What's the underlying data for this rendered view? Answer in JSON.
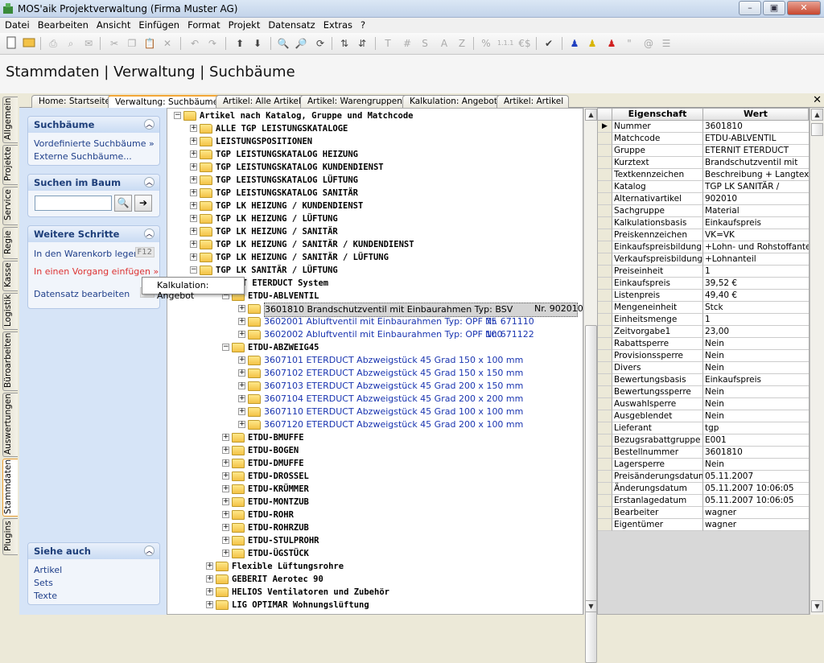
{
  "window": {
    "title": "MOS'aik Projektverwaltung (Firma Muster AG)",
    "min": "–",
    "max": "▣",
    "close": "✕"
  },
  "menu": [
    "Datei",
    "Bearbeiten",
    "Ansicht",
    "Einfügen",
    "Format",
    "Projekt",
    "Datensatz",
    "Extras",
    "?"
  ],
  "toolbar": {
    "t1": "T",
    "t2": "#",
    "t3": "S",
    "t4": "A",
    "t5": "Z",
    "t6": "%",
    "t7": "1.1.1",
    "t8": "€$",
    "t9": "\"",
    "t10": "@"
  },
  "page_title": "Stammdaten | Verwaltung | Suchbäume",
  "side_tabs": [
    "Allgemein",
    "Projekte",
    "Service",
    "Regie",
    "Kasse",
    "Logistik",
    "Büroarbeiten",
    "Auswertungen",
    "Stammdaten",
    "Plugins"
  ],
  "tabs": [
    "Home: Startseite",
    "Verwaltung: Suchbäume",
    "Artikel: Alle Artikel",
    "Artikel: Warengruppen",
    "Kalkulation: Angebot",
    "Artikel: Artikel"
  ],
  "tab_close": "✕",
  "left": {
    "b1": {
      "title": "Suchbäume",
      "links": [
        "Vordefinierte Suchbäume »",
        "Externe Suchbäume..."
      ]
    },
    "b2": {
      "title": "Suchen im Baum",
      "input": "",
      "btn1": "🔍",
      "btn2": "➔"
    },
    "b3": {
      "title": "Weitere Schritte",
      "l1": "In den Warenkorb legen",
      "k1": "F12",
      "l2": "In einen Vorgang einfügen »",
      "l3": "Datensatz bearbeiten",
      "k3": "F4"
    },
    "b4": {
      "title": "Siehe auch",
      "links": [
        "Artikel",
        "Sets",
        "Texte"
      ]
    }
  },
  "context_menu": "Kalkulation: Angebot",
  "tree": {
    "root": "Artikel nach Katalog, Gruppe und Matchcode",
    "top": [
      "ALLE TGP LEISTUNGSKATALOGE",
      "LEISTUNGSPOSITIONEN",
      "TGP LEISTUNGSKATALOG HEIZUNG",
      "TGP LEISTUNGSKATALOG KUNDENDIENST",
      "TGP LEISTUNGSKATALOG LÜFTUNG",
      "TGP LEISTUNGSKATALOG SANITÄR",
      "TGP LK HEIZUNG / KUNDENDIENST",
      "TGP LK HEIZUNG / LÜFTUNG",
      "TGP LK HEIZUNG / SANITÄR",
      "TGP LK HEIZUNG / SANITÄR / KUNDENDIENST",
      "TGP LK HEIZUNG / SANITÄR / LÜFTUNG",
      "TGP LK SANITÄR / LÜFTUNG"
    ],
    "sub": "NIT ETERDUCT System",
    "g1": "ETDU-ABLVENTIL",
    "g1items": [
      {
        "t": "3601810 Brandschutzventil mit Einbaurahmen Typ: BSV",
        "nr": "Nr. 902010"
      },
      {
        "t": "3602001 Abluftventil mit Einbaurahmen Typ: OPF 75",
        "nr": "Nr. 671110"
      },
      {
        "t": "3602002 Abluftventil mit Einbaurahmen Typ: OPF 100",
        "nr": "Nr. 671122"
      }
    ],
    "g2": "ETDU-ABZWEIG45",
    "g2items": [
      "3607101 ETERDUCT Abzweigstück 45 Grad 150 x 100 mm",
      "3607102 ETERDUCT Abzweigstück 45 Grad 150 x 150 mm",
      "3607103 ETERDUCT Abzweigstück 45 Grad 200 x 150 mm",
      "3607104 ETERDUCT Abzweigstück 45 Grad 200 x 200 mm",
      "3607110 ETERDUCT Abzweigstück 45 Grad 100 x 100 mm",
      "3607120 ETERDUCT Abzweigstück 45 Grad 200 x 100 mm"
    ],
    "groups": [
      "ETDU-BMUFFE",
      "ETDU-BOGEN",
      "ETDU-DMUFFE",
      "ETDU-DROSSEL",
      "ETDU-KRÜMMER",
      "ETDU-MONTZUB",
      "ETDU-ROHR",
      "ETDU-ROHRZUB",
      "ETDU-STULPROHR",
      "ETDU-ÜGSTÜCK"
    ],
    "bottom": [
      "Flexible Lüftungsrohre",
      "GEBERIT Aerotec 90",
      "HELIOS Ventilatoren und Zubehör",
      "LIG OPTIMAR Wohnungslüftung"
    ]
  },
  "props": {
    "h1": "Eigenschaft",
    "h2": "Wert",
    "marker": "▶",
    "rows": [
      [
        "Nummer",
        "3601810"
      ],
      [
        "Matchcode",
        "ETDU-ABLVENTIL"
      ],
      [
        "Gruppe",
        "ETERNIT ETERDUCT"
      ],
      [
        "Kurztext",
        "Brandschutzventil mit"
      ],
      [
        "Textkennzeichen",
        "Beschreibung + Langtext"
      ],
      [
        "Katalog",
        "TGP LK  SANITÄR /"
      ],
      [
        "Alternativartikel",
        "902010"
      ],
      [
        "Sachgruppe",
        "Material"
      ],
      [
        "Kalkulationsbasis",
        "Einkaufspreis"
      ],
      [
        "Preiskennzeichen",
        "VK=VK"
      ],
      [
        "Einkaufspreisbildung",
        "+Lohn- und Rohstoffanteil"
      ],
      [
        "Verkaufspreisbildung",
        "+Lohnanteil"
      ],
      [
        "Preiseinheit",
        "1"
      ],
      [
        "Einkaufspreis",
        "39,52 €"
      ],
      [
        "Listenpreis",
        "49,40 €"
      ],
      [
        "Mengeneinheit",
        "Stck"
      ],
      [
        "Einheitsmenge",
        "1"
      ],
      [
        "Zeitvorgabe1",
        "23,00"
      ],
      [
        "Rabattsperre",
        "Nein"
      ],
      [
        "Provisionssperre",
        "Nein"
      ],
      [
        "Divers",
        "Nein"
      ],
      [
        "Bewertungsbasis",
        "Einkaufspreis"
      ],
      [
        "Bewertungssperre",
        "Nein"
      ],
      [
        "Auswahlsperre",
        "Nein"
      ],
      [
        "Ausgeblendet",
        "Nein"
      ],
      [
        "Lieferant",
        "tgp"
      ],
      [
        "Bezugsrabattgruppe",
        "E001"
      ],
      [
        "Bestellnummer",
        "3601810"
      ],
      [
        "Lagersperre",
        "Nein"
      ],
      [
        "Preisänderungsdatum",
        "05.11.2007"
      ],
      [
        "Änderungsdatum",
        "05.11.2007 10:06:05"
      ],
      [
        "Erstanlagedatum",
        "05.11.2007 10:06:05"
      ],
      [
        "Bearbeiter",
        "wagner"
      ],
      [
        "Eigentümer",
        "wagner"
      ]
    ]
  },
  "scroll": {
    "up": "▲",
    "down": "▼"
  }
}
